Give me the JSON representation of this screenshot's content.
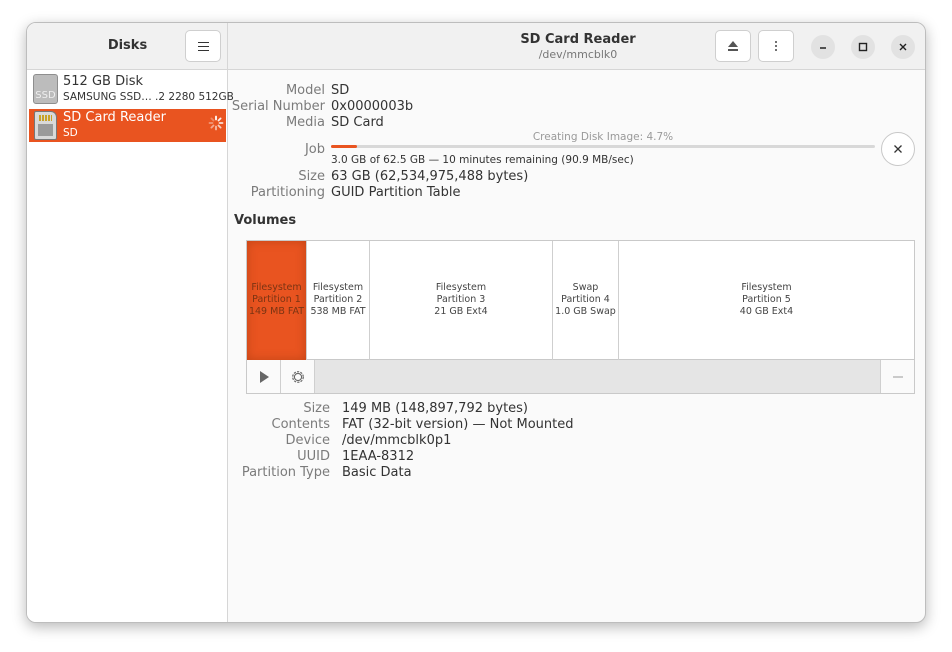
{
  "sidebar": {
    "title": "Disks",
    "menu_icon": "hamburger-icon",
    "disks": [
      {
        "name": "512 GB Disk",
        "subtitle": "SAMSUNG SSD… .2 2280 512GB",
        "icon": "ssd-icon",
        "icon_text": "SSD"
      },
      {
        "name": "SD Card Reader",
        "subtitle": "SD",
        "icon": "sd-card-icon",
        "busy": true
      }
    ]
  },
  "header": {
    "title": "SD Card Reader",
    "subtitle": "/dev/mmcblk0",
    "eject_icon": "eject-icon",
    "more_icon": "vertical-dots-icon",
    "minimize_icon": "minimize-icon",
    "maximize_icon": "maximize-icon",
    "close_icon": "close-icon"
  },
  "drive": {
    "model_label": "Model",
    "model": "SD",
    "serial_label": "Serial Number",
    "serial": "0x0000003b",
    "media_label": "Media",
    "media": "SD Card",
    "job_label": "Job",
    "job_caption": "Creating Disk Image: 4.7%",
    "job_progress_percent": 4.7,
    "job_detail": "3.0 GB of 62.5 GB — 10 minutes remaining (90.9 MB/sec)",
    "size_label": "Size",
    "size": "63 GB (62,534,975,488 bytes)",
    "partitioning_label": "Partitioning",
    "partitioning": "GUID Partition Table"
  },
  "volumes": {
    "title": "Volumes",
    "partitions": [
      {
        "line1": "Filesystem",
        "line2": "Partition 1",
        "line3": "149 MB FAT",
        "selected": true
      },
      {
        "line1": "Filesystem",
        "line2": "Partition 2",
        "line3": "538 MB FAT"
      },
      {
        "line1": "Filesystem",
        "line2": "Partition 3",
        "line3": "21 GB Ext4"
      },
      {
        "line1": "Swap",
        "line2": "Partition 4",
        "line3": "1.0 GB Swap"
      },
      {
        "line1": "Filesystem",
        "line2": "Partition 5",
        "line3": "40 GB Ext4"
      }
    ],
    "toolbar": {
      "mount_icon": "play-icon",
      "settings_icon": "gear-icon",
      "remove_icon": "minus-icon"
    }
  },
  "partition_details": {
    "size_label": "Size",
    "size": "149 MB (148,897,792 bytes)",
    "contents_label": "Contents",
    "contents": "FAT (32-bit version) — Not Mounted",
    "device_label": "Device",
    "device": "/dev/mmcblk0p1",
    "uuid_label": "UUID",
    "uuid": "1EAA-8312",
    "type_label": "Partition Type",
    "type": "Basic Data"
  },
  "colors": {
    "accent": "#e95420",
    "label": "#7b7b7b"
  }
}
